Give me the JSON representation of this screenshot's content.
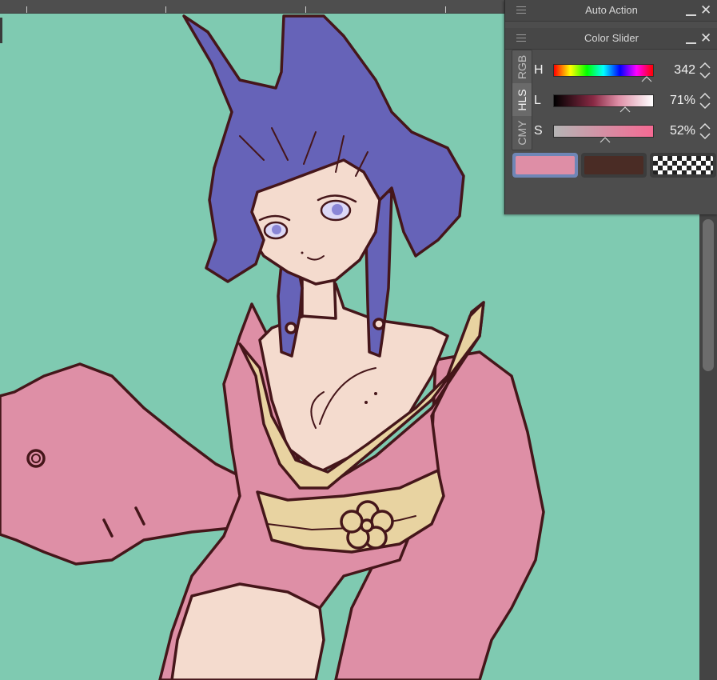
{
  "app": {
    "panels": {
      "auto_action": {
        "title": "Auto Action"
      },
      "color_slider": {
        "title": "Color Slider",
        "tabs": [
          {
            "label": "RGB",
            "active": false
          },
          {
            "label": "HLS",
            "active": true
          },
          {
            "label": "CMY",
            "active": false
          }
        ],
        "sliders": [
          {
            "label": "H",
            "value": "342",
            "name": "hue"
          },
          {
            "label": "L",
            "value": "71%",
            "name": "lightness"
          },
          {
            "label": "S",
            "value": "52%",
            "name": "saturation"
          }
        ],
        "swatches": {
          "main": "#de8ea6",
          "sub": "#4a2c25",
          "transparent": "checker"
        }
      }
    }
  },
  "colors": {
    "canvas_bg": "#7fcab1",
    "hair": "#6663b8",
    "skin": "#f4dbce",
    "kimono": "#de8fa6",
    "sash": "#e8d3a1",
    "line": "#45161a"
  },
  "icons": [
    "menu-icon",
    "minimize-icon",
    "close-icon",
    "spin-arrows-icon"
  ]
}
